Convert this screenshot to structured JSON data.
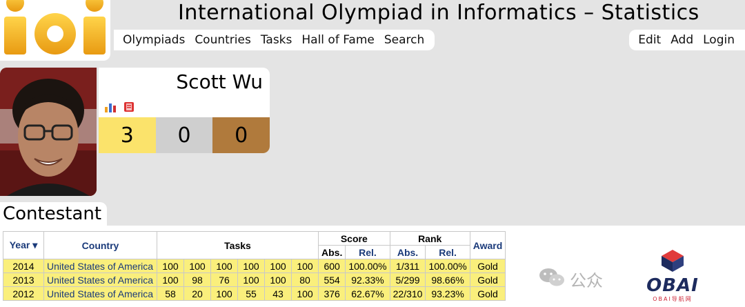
{
  "site": {
    "title": "International Olympiad in Informatics – Statistics",
    "logo_text": "ioi"
  },
  "nav": {
    "left": [
      "Olympiads",
      "Countries",
      "Tasks",
      "Hall of Fame",
      "Search"
    ],
    "right": [
      "Edit",
      "Add",
      "Login"
    ]
  },
  "profile": {
    "name": "Scott Wu",
    "icons": [
      "bar-chart-icon",
      "id-card-icon"
    ],
    "medals": {
      "gold": "3",
      "silver": "0",
      "bronze": "0"
    }
  },
  "section": {
    "title": "Contestant"
  },
  "table": {
    "headers": {
      "year": "Year ▾",
      "country": "Country",
      "tasks": "Tasks",
      "score": "Score",
      "rank": "Rank",
      "award": "Award",
      "abs": "Abs.",
      "rel": "Rel."
    },
    "rows": [
      {
        "year": "2014",
        "country": "United States of America",
        "tasks": [
          "100",
          "100",
          "100",
          "100",
          "100",
          "100"
        ],
        "score_abs": "600",
        "score_rel": "100.00%",
        "rank_abs": "1/311",
        "rank_rel": "100.00%",
        "award": "Gold"
      },
      {
        "year": "2013",
        "country": "United States of America",
        "tasks": [
          "100",
          "98",
          "76",
          "100",
          "100",
          "80"
        ],
        "score_abs": "554",
        "score_rel": "92.33%",
        "rank_abs": "5/299",
        "rank_rel": "98.66%",
        "award": "Gold"
      },
      {
        "year": "2012",
        "country": "United States of America",
        "tasks": [
          "58",
          "20",
          "100",
          "55",
          "43",
          "100"
        ],
        "score_abs": "376",
        "score_rel": "62.67%",
        "rank_abs": "22/310",
        "rank_rel": "93.23%",
        "award": "Gold"
      }
    ]
  },
  "watermark": {
    "chat_text": "公众",
    "brand": "OBAI",
    "brand_sub": "OBAI导航网"
  },
  "colors": {
    "gold": "#fbe36b",
    "silver": "#cfcfcf",
    "bronze": "#b07a3c",
    "row_bg": "#faef7c",
    "link": "#1a3a7a",
    "page_bg": "#e4e4e4"
  }
}
